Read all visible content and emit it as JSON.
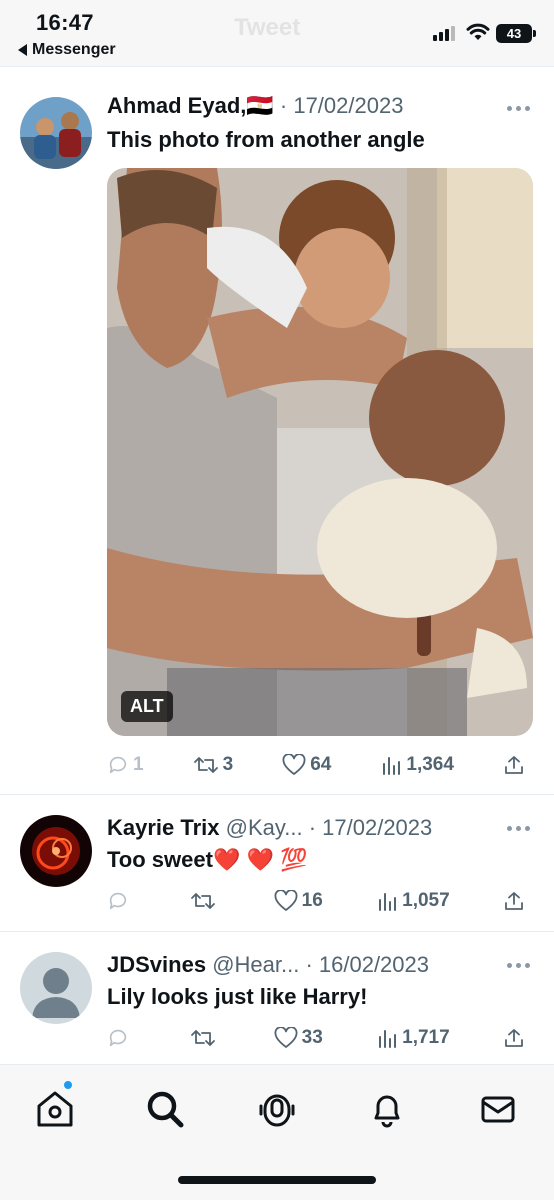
{
  "status_bar": {
    "time": "16:47",
    "back_label": "Messenger",
    "faded_title": "Tweet",
    "battery": "43"
  },
  "tweets": [
    {
      "author": "Ahmad Eyad,🇪🇬",
      "handle": "",
      "date": "· 17/02/2023",
      "text": "This photo from another angle",
      "alt_badge": "ALT",
      "replies": "1",
      "retweets": "3",
      "likes": "64",
      "views": "1,364"
    },
    {
      "author": "Kayrie Trix",
      "handle": "@Kay...",
      "date": "· 17/02/2023",
      "text": "Too sweet❤️ ❤️ 💯",
      "replies": "",
      "retweets": "",
      "likes": "16",
      "views": "1,057"
    },
    {
      "author": "JDSvines",
      "handle": "@Hear...",
      "date": "· 16/02/2023",
      "text": "Lily looks just like Harry!",
      "replies": "",
      "retweets": "",
      "likes": "33",
      "views": "1,717"
    }
  ],
  "nav": [
    "home-icon",
    "search-icon",
    "spaces-icon",
    "notifications-icon",
    "messages-icon"
  ],
  "colors": {
    "accent": "#1d9bf0",
    "text": "#0f1419",
    "muted": "#536471"
  }
}
